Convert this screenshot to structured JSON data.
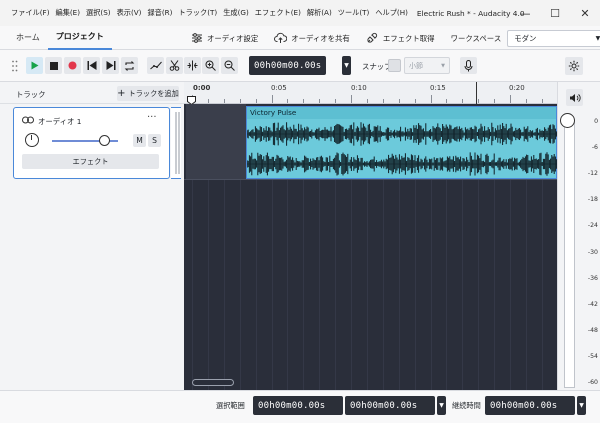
{
  "titlebar": {
    "menu": [
      "ファイル(F)",
      "編集(E)",
      "選択(S)",
      "表示(V)",
      "録音(R)",
      "トラック(T)",
      "生成(G)",
      "エフェクト(E)",
      "解析(A)",
      "ツール(T)",
      "ヘルプ(H)"
    ],
    "app_title": "Electric Rush * - Audacity 4.0",
    "minimize": "—",
    "maximize": "☐",
    "close": "✕"
  },
  "tabs": {
    "home": "ホーム",
    "project": "プロジェクト",
    "audio_settings": "オーディオ設定",
    "share_audio": "オーディオを共有",
    "get_effects": "エフェクト取得",
    "workspace_label": "ワークスペース",
    "workspace_value": "モダン"
  },
  "toolbar": {
    "time": "00h00m00.00s",
    "snap_label": "スナップ",
    "snap_unit": "小節"
  },
  "track_panel": {
    "title": "トラック",
    "add_track": "トラックを追加",
    "track_name": "オーディオ 1",
    "mute": "M",
    "solo": "S",
    "effects": "エフェクト",
    "gain": 0.8
  },
  "timeline": {
    "ticks": [
      "0:00",
      "0:05",
      "0:10",
      "0:15",
      "0:20"
    ],
    "clip_name": "Victory Pulse"
  },
  "meter": {
    "labels": [
      "0",
      "-6",
      "-12",
      "-18",
      "-24",
      "-30",
      "-36",
      "-42",
      "-48",
      "-54",
      "-60"
    ]
  },
  "bottombar": {
    "selection_label": "選択範囲",
    "selection_start": "00h00m00.00s",
    "selection_end": "00h00m00.00s",
    "duration_label": "継続時間",
    "duration": "00h00m00.00s"
  }
}
